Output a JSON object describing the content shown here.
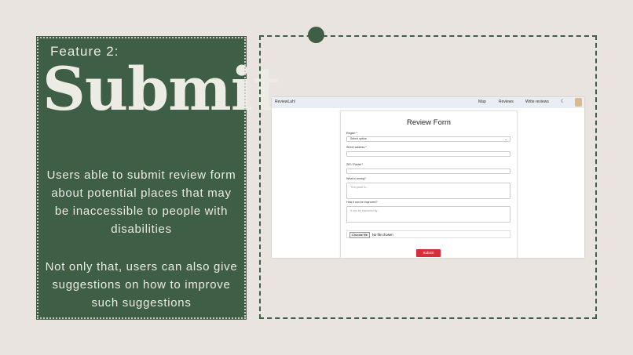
{
  "slide": {
    "feature_label": "Feature 2:",
    "title": "Submit",
    "description_1": "Users able to submit review form about potential places that may be inaccessible to people with disabilities",
    "description_2": "Not only that, users can also give suggestions on how to improve such suggestions",
    "colors": {
      "background": "#e9e4df",
      "green": "#3e5f45",
      "text": "#ecebe4"
    }
  },
  "screenshot": {
    "navbar": {
      "brand": "ReviewLah!",
      "links": [
        "Map",
        "Reviews",
        "Write reviews"
      ],
      "theme_icon": "moon-icon",
      "avatar_icon": "avatar-icon"
    },
    "form": {
      "title": "Review Form",
      "region_label": "Region *",
      "region_value": "Select option",
      "street_label": "Street address *",
      "zip_label": "ZIP / Postal *",
      "wrong_label": "What is wrong?",
      "wrong_placeholder": "This place is...",
      "improve_label": "How it can be improved?",
      "improve_placeholder": "It can be improved by...",
      "file_button": "Choose file",
      "file_status": "No file chosen",
      "submit_label": "Submit",
      "submit_color": "#d62f3a"
    }
  }
}
